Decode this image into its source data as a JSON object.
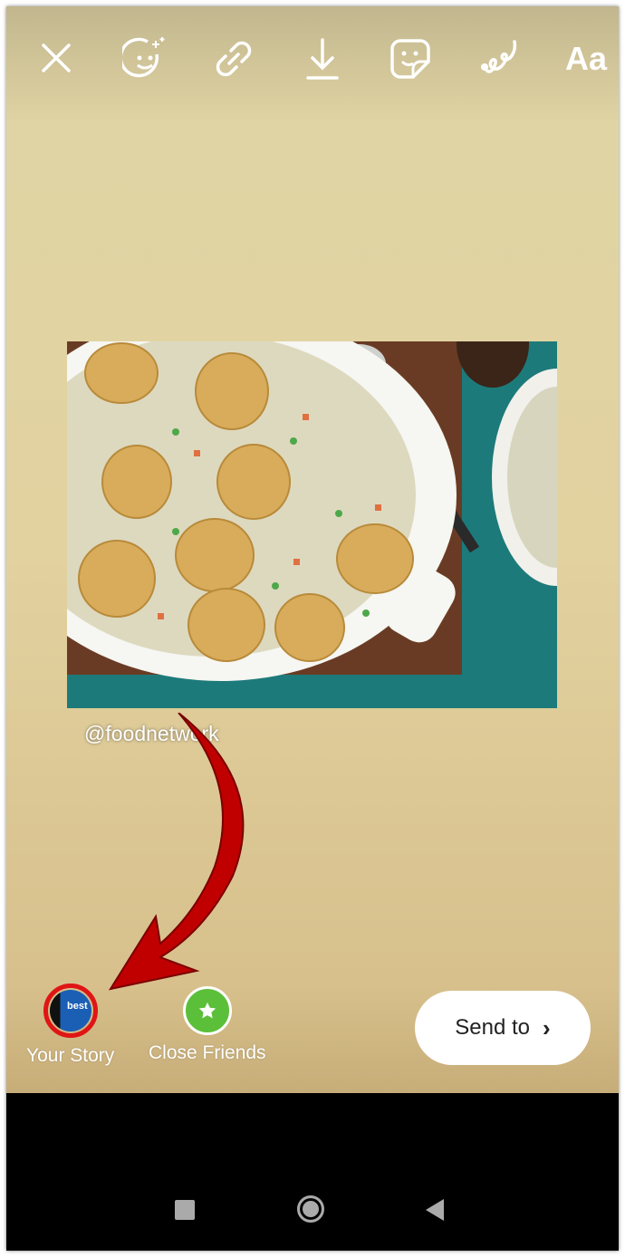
{
  "toolbar": {
    "items": [
      {
        "icon": "close-icon"
      },
      {
        "icon": "face-effects-icon"
      },
      {
        "icon": "link-icon"
      },
      {
        "icon": "download-icon"
      },
      {
        "icon": "sticker-icon"
      },
      {
        "icon": "draw-icon"
      },
      {
        "icon": "text-icon",
        "label": "Aa"
      }
    ]
  },
  "post": {
    "mention": "@foodnetwork"
  },
  "share": {
    "your_story": {
      "label": "Your Story",
      "avatar_text": "best"
    },
    "close_friends": {
      "label": "Close Friends",
      "color": "#5bbf3a"
    },
    "send_to": {
      "label": "Send to",
      "chevron": "›"
    }
  },
  "colors": {
    "highlight_ring": "#e01515",
    "arrow": "#c00000"
  }
}
